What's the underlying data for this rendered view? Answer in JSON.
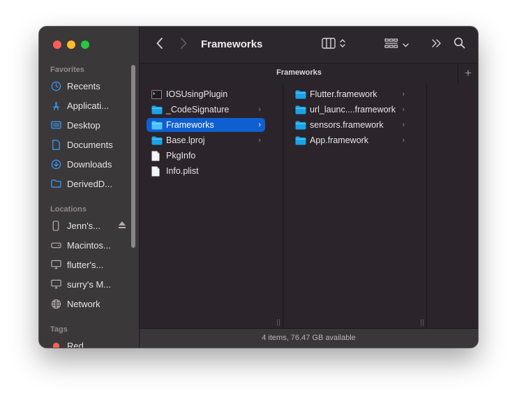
{
  "window": {
    "title": "Frameworks",
    "tab_title": "Frameworks",
    "status": "4 items, 76.47 GB available"
  },
  "sidebar": {
    "favorites_heading": "Favorites",
    "favorites": [
      {
        "label": "Recents",
        "icon": "clock-icon"
      },
      {
        "label": "Applicati...",
        "icon": "applications-icon"
      },
      {
        "label": "Desktop",
        "icon": "desktop-icon"
      },
      {
        "label": "Documents",
        "icon": "document-icon"
      },
      {
        "label": "Downloads",
        "icon": "download-icon"
      },
      {
        "label": "DerivedD...",
        "icon": "folder-icon"
      }
    ],
    "locations_heading": "Locations",
    "locations": [
      {
        "label": "Jenn's...",
        "icon": "iphone-icon"
      },
      {
        "label": "Macintos...",
        "icon": "hard-drive-icon"
      },
      {
        "label": "flutter's...",
        "icon": "display-icon"
      },
      {
        "label": "surry's M...",
        "icon": "display-icon"
      },
      {
        "label": "Network",
        "icon": "globe-icon"
      }
    ],
    "tags_heading": "Tags",
    "tags": [
      {
        "label": "Red",
        "color": "#ff5f57"
      }
    ]
  },
  "columns": [
    {
      "items": [
        {
          "label": "IOSUsingPlugin",
          "type": "executable",
          "has_children": false,
          "selected": false
        },
        {
          "label": "_CodeSignature",
          "type": "folder",
          "has_children": true,
          "selected": false
        },
        {
          "label": "Frameworks",
          "type": "folder",
          "has_children": true,
          "selected": true
        },
        {
          "label": "Base.lproj",
          "type": "folder",
          "has_children": true,
          "selected": false
        },
        {
          "label": "PkgInfo",
          "type": "file",
          "has_children": false,
          "selected": false
        },
        {
          "label": "Info.plist",
          "type": "file",
          "has_children": false,
          "selected": false
        }
      ]
    },
    {
      "items": [
        {
          "label": "Flutter.framework",
          "type": "folder",
          "has_children": true,
          "selected": false
        },
        {
          "label": "url_launc....framework",
          "type": "folder",
          "has_children": true,
          "selected": false
        },
        {
          "label": "sensors.framework",
          "type": "folder",
          "has_children": true,
          "selected": false
        },
        {
          "label": "App.framework",
          "type": "folder",
          "has_children": true,
          "selected": false
        }
      ]
    }
  ],
  "colors": {
    "accent": "#0f5fd1",
    "folder": "#1aa3e8"
  }
}
